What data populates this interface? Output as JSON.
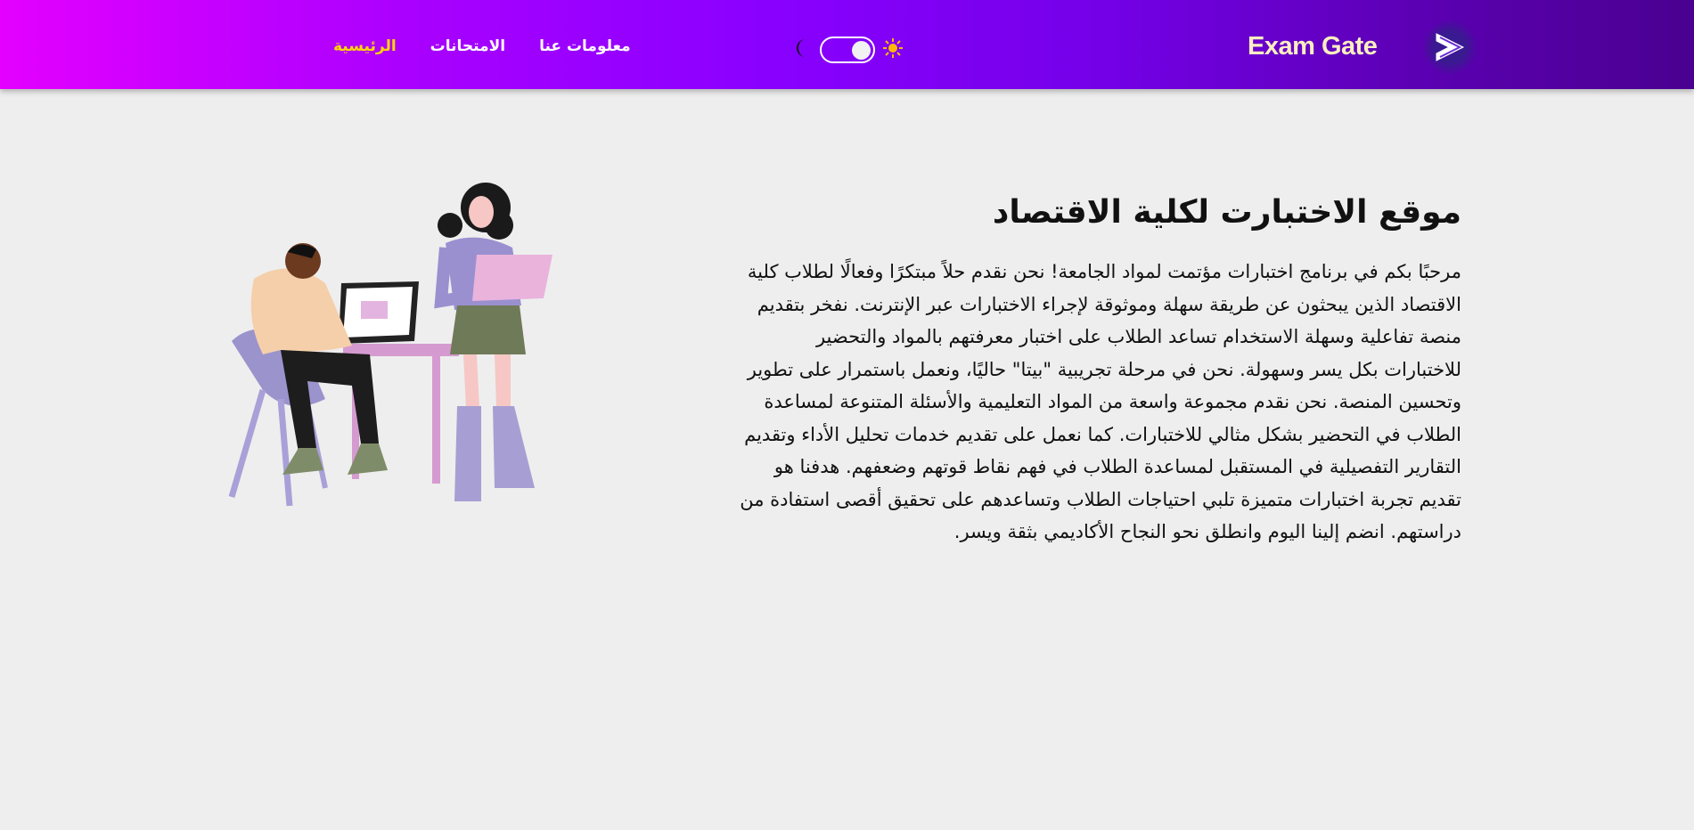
{
  "brand": {
    "name": "Exam Gate",
    "icon": "arrow-right-icon"
  },
  "theme_toggle": {
    "dark_icon": "moon-icon",
    "light_icon": "sun-icon",
    "state": "light"
  },
  "nav": {
    "links": [
      {
        "label": "الرئيسية",
        "active": true
      },
      {
        "label": "الامتحانات",
        "active": false
      },
      {
        "label": "معلومات عنا",
        "active": false
      }
    ]
  },
  "colors": {
    "active_link": "#ffd700",
    "brand_text": "#fbeec0"
  },
  "hero": {
    "title": "موقع الاختبارت لكلية الاقتصاد",
    "body": "مرحبًا بكم في برنامج اختبارات مؤتمت لمواد الجامعة! نحن نقدم حلاً مبتكرًا وفعالًا لطلاب كلية الاقتصاد الذين يبحثون عن طريقة سهلة وموثوقة لإجراء الاختبارات عبر الإنترنت. نفخر بتقديم منصة تفاعلية وسهلة الاستخدام تساعد الطلاب على اختبار معرفتهم بالمواد والتحضير للاختبارات بكل يسر وسهولة. نحن في مرحلة تجريبية \"بيتا\" حاليًا، ونعمل باستمرار على تطوير وتحسين المنصة. نحن نقدم مجموعة واسعة من المواد التعليمية والأسئلة المتنوعة لمساعدة الطلاب في التحضير بشكل مثالي للاختبارات. كما نعمل على تقديم خدمات تحليل الأداء وتقديم التقارير التفصيلية في المستقبل لمساعدة الطلاب في فهم نقاط قوتهم وضعفهم. هدفنا هو تقديم تجربة اختبارات متميزة تلبي احتياجات الطلاب وتساعدهم على تحقيق أقصى استفادة من دراستهم. انضم إلينا اليوم وانطلق نحو النجاح الأكاديمي بثقة ويسر."
  }
}
